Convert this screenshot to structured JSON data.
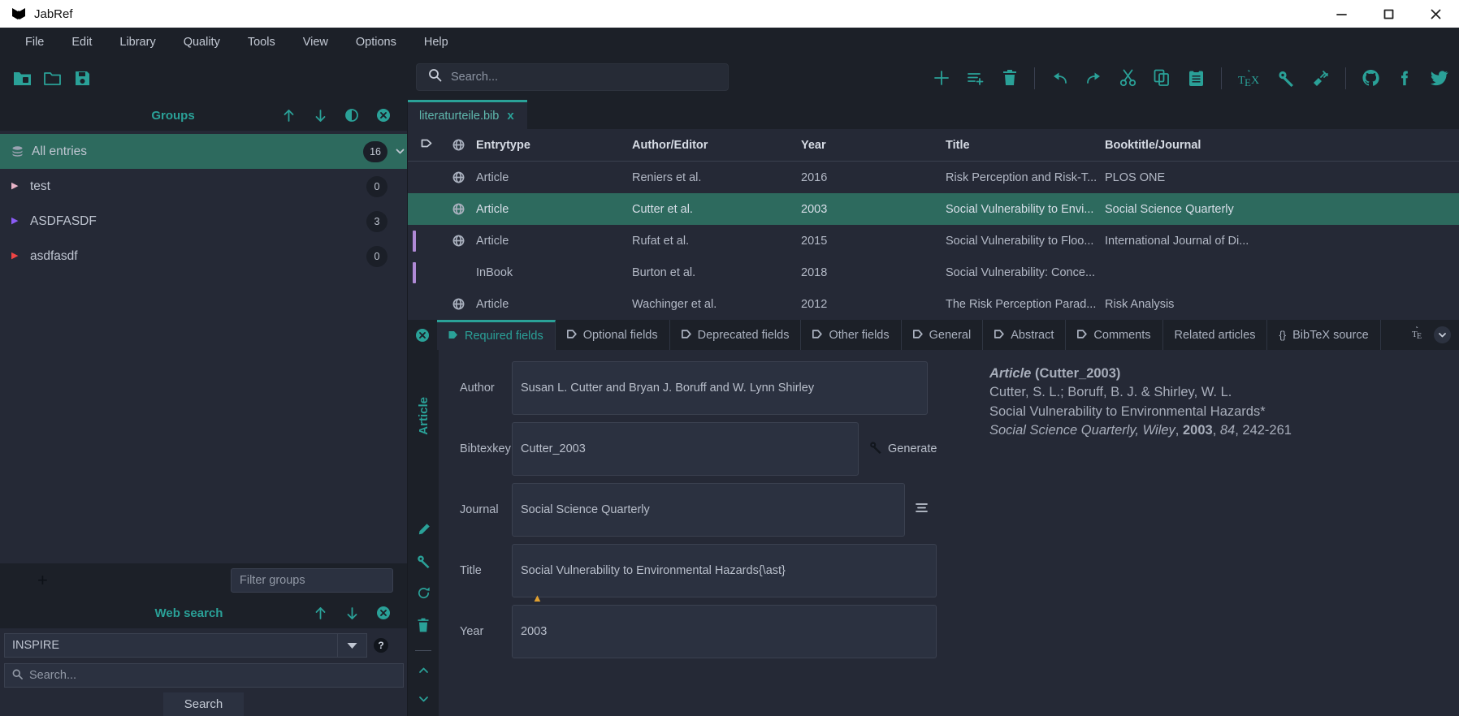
{
  "window": {
    "title": "JabRef",
    "minimize": "minimize-icon",
    "maximize": "maximize-icon",
    "close": "close-icon"
  },
  "menubar": {
    "items": [
      "File",
      "Edit",
      "Library",
      "Quality",
      "Tools",
      "View",
      "Options",
      "Help"
    ]
  },
  "toolbar": {
    "left_icons": [
      "new-library-icon",
      "open-library-icon",
      "save-library-icon"
    ],
    "right_icons": [
      "add-entry-icon",
      "add-entry-from-plaintext-icon",
      "delete-entry-icon",
      "undo-icon",
      "redo-icon",
      "cut-icon",
      "copy-icon",
      "paste-icon",
      "latex-citations-icon",
      "generate-key-icon",
      "cleanup-icon",
      "github-icon",
      "facebook-icon",
      "twitter-icon"
    ]
  },
  "search": {
    "placeholder": "Search...",
    "icon": "search-icon"
  },
  "groups_panel": {
    "title": "Groups",
    "actions": [
      "arrow-up-icon",
      "arrow-down-icon",
      "contrast-icon",
      "close-circle-icon"
    ],
    "items": [
      {
        "label": "All entries",
        "count": "16",
        "icon": "database-icon",
        "selected": true,
        "arrow_color": "#6b7280",
        "has_chevron": true
      },
      {
        "label": "test",
        "count": "0",
        "icon": "triangle-icon",
        "selected": false,
        "arrow_color": "#e8b4c8",
        "has_chevron": false
      },
      {
        "label": "ASDFASDF",
        "count": "3",
        "icon": "triangle-icon",
        "selected": false,
        "arrow_color": "#8b5cf6",
        "has_chevron": false
      },
      {
        "label": "asdfasdf",
        "count": "0",
        "icon": "triangle-icon",
        "selected": false,
        "arrow_color": "#ef4444",
        "has_chevron": false
      }
    ],
    "add_label": "+",
    "filter_placeholder": "Filter groups"
  },
  "web_search": {
    "title": "Web search",
    "actions": [
      "arrow-up-icon",
      "arrow-down-icon",
      "close-circle-icon"
    ],
    "selected_source": "INSPIRE",
    "help_label": "?",
    "search_placeholder": "Search...",
    "search_button": "Search"
  },
  "library_tab": {
    "name": "literaturteile.bib",
    "close": "x"
  },
  "entry_table": {
    "columns": [
      "",
      "",
      "Entrytype",
      "Author/Editor",
      "Year",
      "Title",
      "Booktitle/Journal"
    ],
    "rows": [
      {
        "group_color": "",
        "linked": true,
        "entrytype": "Article",
        "author": "Reniers et al.",
        "year": "2016",
        "title": "Risk Perception and Risk-T...",
        "journal": "PLOS ONE",
        "selected": false
      },
      {
        "group_color": "",
        "linked": true,
        "entrytype": "Article",
        "author": "Cutter et al.",
        "year": "2003",
        "title": "Social Vulnerability to Envi...",
        "journal": "Social Science Quarterly",
        "selected": true
      },
      {
        "group_color": "#b08ad6",
        "linked": true,
        "entrytype": "Article",
        "author": "Rufat et al.",
        "year": "2015",
        "title": "Social Vulnerability to Floo...",
        "journal": "International Journal of Di...",
        "selected": false
      },
      {
        "group_color": "#b08ad6",
        "linked": false,
        "entrytype": "InBook",
        "author": "Burton et al.",
        "year": "2018",
        "title": "Social Vulnerability: Conce...",
        "journal": "",
        "selected": false
      },
      {
        "group_color": "",
        "linked": true,
        "entrytype": "Article",
        "author": "Wachinger et al.",
        "year": "2012",
        "title": "The Risk Perception Parad...",
        "journal": "Risk Analysis",
        "selected": false
      }
    ]
  },
  "entry_editor": {
    "tabs": [
      {
        "label": "Required fields",
        "icon": "filled-tab-icon",
        "active": true
      },
      {
        "label": "Optional fields",
        "icon": "tab-icon",
        "active": false
      },
      {
        "label": "Deprecated fields",
        "icon": "tab-icon",
        "active": false
      },
      {
        "label": "Other fields",
        "icon": "tab-icon",
        "active": false
      },
      {
        "label": "General",
        "icon": "tab-icon",
        "active": false
      },
      {
        "label": "Abstract",
        "icon": "tab-icon",
        "active": false
      },
      {
        "label": "Comments",
        "icon": "tab-icon",
        "active": false
      },
      {
        "label": "Related articles",
        "icon": "",
        "active": false
      },
      {
        "label": "BibTeX source",
        "icon": "braces-icon",
        "active": false
      }
    ],
    "type_label": "Article",
    "side_icons": [
      "edit-icon",
      "key-icon",
      "refresh-icon",
      "delete-icon",
      "chevron-up-icon",
      "chevron-down-icon"
    ],
    "close_icon": "close-circle-icon",
    "fields": [
      {
        "label": "Author",
        "value": "Susan L. Cutter and Bryan J. Boruff and W. Lynn Shirley"
      },
      {
        "label": "Bibtexkey",
        "value": "Cutter_2003"
      },
      {
        "label": "Journal",
        "value": "Social Science Quarterly"
      },
      {
        "label": "Title",
        "value": "Social Vulnerability to Environmental Hazards{\\ast}"
      },
      {
        "label": "Year",
        "value": "2003"
      }
    ],
    "generate_button": "Generate",
    "preview": {
      "line1_type": "Article",
      "line1_key": " (Cutter_2003)",
      "line2": "Cutter, S. L.; Boruff, B. J. & Shirley, W. L.",
      "line3": "Social Vulnerability to Environmental Hazards*",
      "line4_journal": "Social Science Quarterly, Wiley",
      "line4_year": "2003",
      "line4_vol": "84",
      "line4_pages": "242-261"
    }
  },
  "colors": {
    "accent": "#2aa198",
    "selection": "#2d6a5e",
    "panel_bg": "#252936",
    "app_bg": "#1c2028"
  }
}
